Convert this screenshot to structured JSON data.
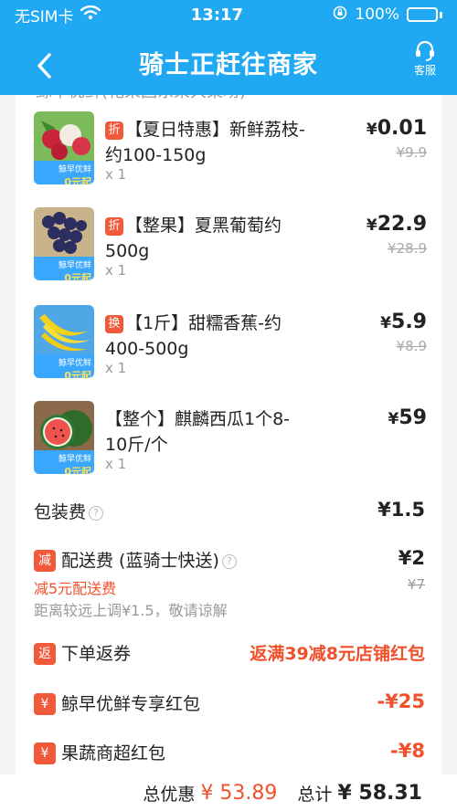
{
  "status": {
    "carrier": "无SIM卡",
    "time": "13:17",
    "battery": "100%"
  },
  "nav": {
    "title": "骑士正赶往商家",
    "service": "客服"
  },
  "shop_peek": "鲸早优鲜(花果园东果大菜场)",
  "items": [
    {
      "tag": "折",
      "name": "【夏日特惠】新鲜荔枝-约100-150g",
      "qty": "x 1",
      "price": "0.01",
      "orig": "¥9.9",
      "fruit": "lychee"
    },
    {
      "tag": "折",
      "name": "【整果】夏黑葡萄约500g",
      "qty": "x 1",
      "price": "22.9",
      "orig": "¥28.9",
      "fruit": "grape"
    },
    {
      "tag": "换",
      "name": "【1斤】甜糯香蕉-约400-500g",
      "qty": "x 1",
      "price": "5.9",
      "orig": "¥8.9",
      "fruit": "banana"
    },
    {
      "tag": "",
      "name": "【整个】麒麟西瓜1个8-10斤/个",
      "qty": "x 1",
      "price": "59",
      "orig": "",
      "fruit": "watermelon"
    }
  ],
  "thumb_promo": {
    "line1": "鲸早优鲜",
    "line2": "0元起"
  },
  "packing": {
    "label": "包装费",
    "value": "¥1.5"
  },
  "delivery": {
    "badge": "减",
    "label": "配送费 (蓝骑士快送)",
    "value": "¥2",
    "orig": "¥7",
    "discount": "减5元配送费",
    "note": "距离较远上调¥1.5，敬请谅解"
  },
  "coupon": {
    "badge": "返",
    "label": "下单返券",
    "value": "返满39减8元店铺红包"
  },
  "redpacket1": {
    "badge": "¥",
    "label": "鲸早优鲜专享红包",
    "value": "-¥25"
  },
  "redpacket2": {
    "badge": "¥",
    "label": "果蔬商超红包",
    "value": "-¥8"
  },
  "footer": {
    "discount_label": "总优惠",
    "discount_value": "¥ 53.89",
    "total_label": "总计",
    "total_value": "¥ 58.31"
  },
  "colors": {
    "header": "#20a9f2",
    "accent": "#f0502b"
  }
}
